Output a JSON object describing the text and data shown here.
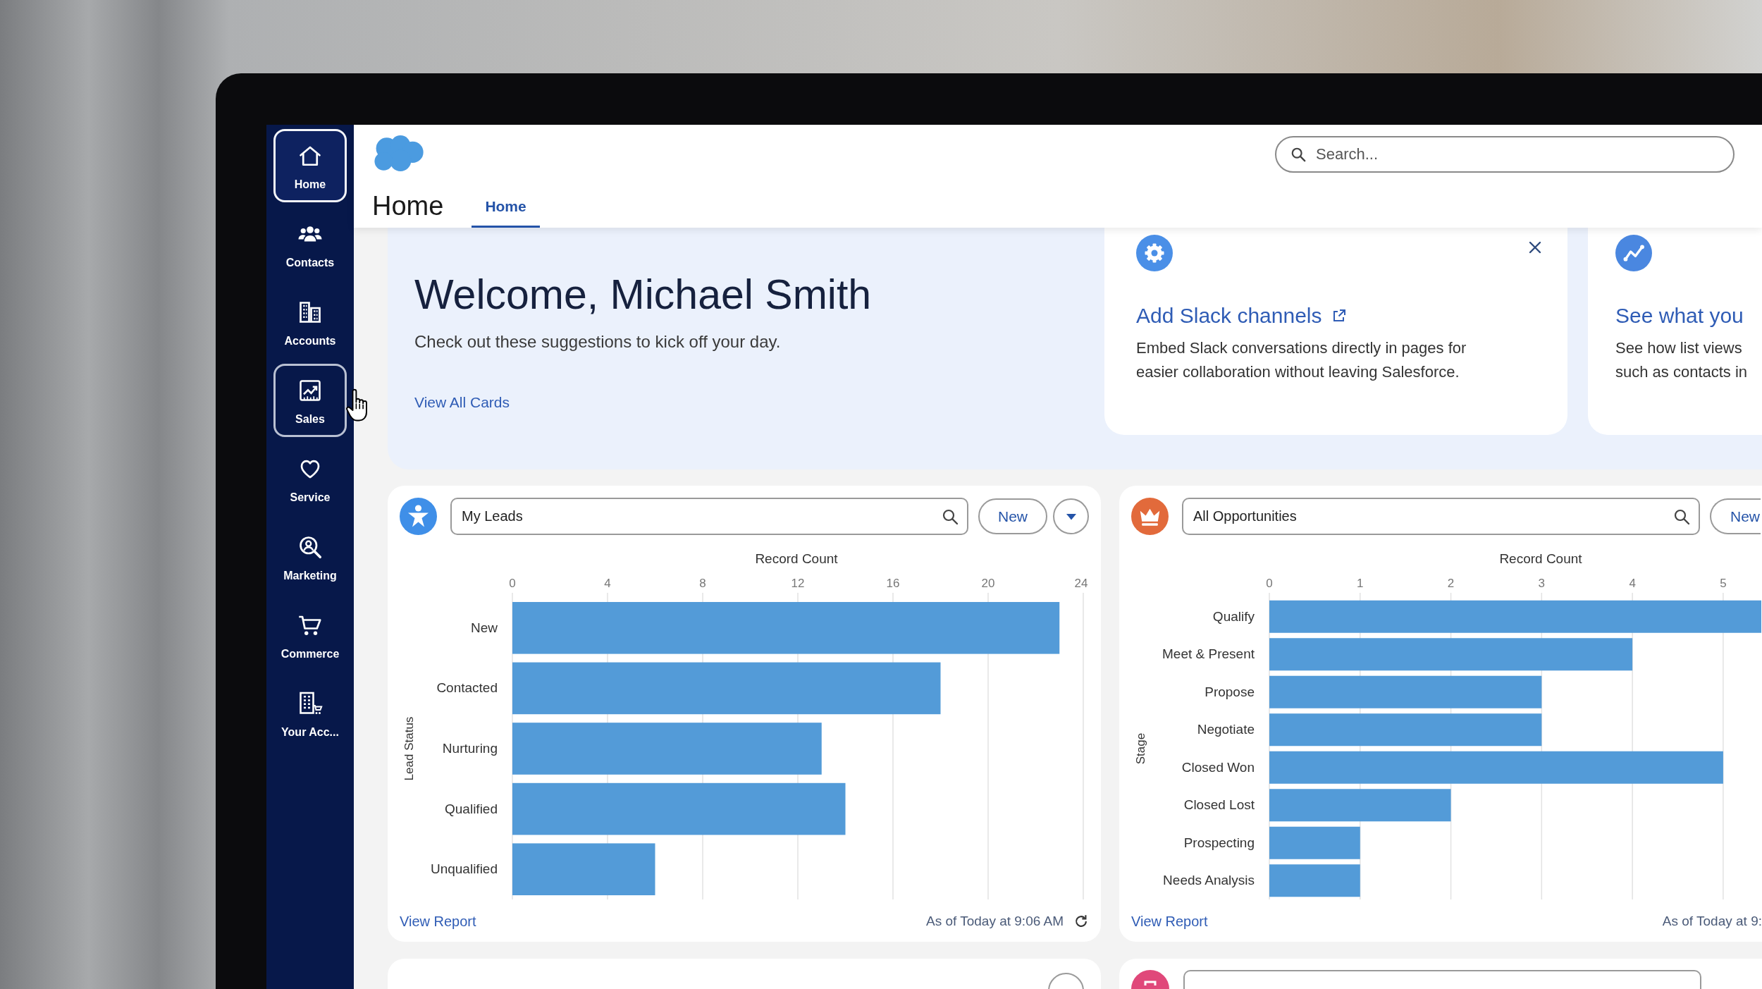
{
  "sidebar": {
    "items": [
      {
        "label": "Home",
        "selected": true,
        "hovered": false
      },
      {
        "label": "Contacts",
        "selected": false,
        "hovered": false
      },
      {
        "label": "Accounts",
        "selected": false,
        "hovered": false
      },
      {
        "label": "Sales",
        "selected": false,
        "hovered": true
      },
      {
        "label": "Service",
        "selected": false,
        "hovered": false
      },
      {
        "label": "Marketing",
        "selected": false,
        "hovered": false
      },
      {
        "label": "Commerce",
        "selected": false,
        "hovered": false
      },
      {
        "label": "Your Acc...",
        "selected": false,
        "hovered": false
      }
    ]
  },
  "header": {
    "title": "Home",
    "tabs": [
      {
        "label": "Home",
        "selected": true
      }
    ],
    "search": {
      "placeholder": "Search..."
    }
  },
  "welcome": {
    "title": "Welcome, Michael Smith",
    "subtitle": "Check out these suggestions to kick off your day.",
    "link": "View All Cards"
  },
  "suggestion_cards": [
    {
      "kind": "integration",
      "title": "Add Slack channels",
      "external_link": true,
      "dismissible": true,
      "description": "Embed Slack conversations directly in pages for\neasier collaboration without leaving Salesforce."
    },
    {
      "kind": "insight",
      "title": "See what you",
      "external_link": false,
      "dismissible": false,
      "description": "See how list views\nsuch as contacts in"
    }
  ],
  "list_cards": [
    {
      "kind": "leads",
      "list_view": "My Leads",
      "actions": [
        {
          "kind": "new",
          "label": "New"
        },
        {
          "kind": "menu"
        }
      ],
      "chart_data": {
        "type": "bar",
        "orientation": "horizontal",
        "xlabel": "Record Count",
        "ylabel": "Lead Status",
        "categories": [
          "New",
          "Contacted",
          "Nurturing",
          "Qualified",
          "Unqualified"
        ],
        "values": [
          23,
          18,
          13,
          14,
          6
        ],
        "xlim": [
          0,
          24
        ],
        "xticks": [
          0,
          4,
          8,
          12,
          16,
          20,
          24
        ],
        "grid": true
      },
      "footer_link": "View Report",
      "timestamp": "As of Today at 9:06 AM",
      "refresh": true
    },
    {
      "kind": "opportunities",
      "list_view": "All Opportunities",
      "actions": [
        {
          "kind": "new",
          "label": "New"
        }
      ],
      "chart_data": {
        "type": "bar",
        "orientation": "horizontal",
        "xlabel": "Record Count",
        "ylabel": "Stage",
        "categories": [
          "Qualify",
          "Meet & Present",
          "Propose",
          "Negotiate",
          "Closed Won",
          "Closed Lost",
          "Prospecting",
          "Needs Analysis"
        ],
        "values": [
          5.42,
          4,
          3,
          3,
          5,
          2,
          1,
          1
        ],
        "xlim": [
          0,
          5.42
        ],
        "xticks": [
          0,
          1,
          2,
          3,
          4,
          5
        ],
        "grid": true
      },
      "footer_link": "View Report",
      "timestamp": "As of Today at 9:",
      "refresh": false
    }
  ]
}
